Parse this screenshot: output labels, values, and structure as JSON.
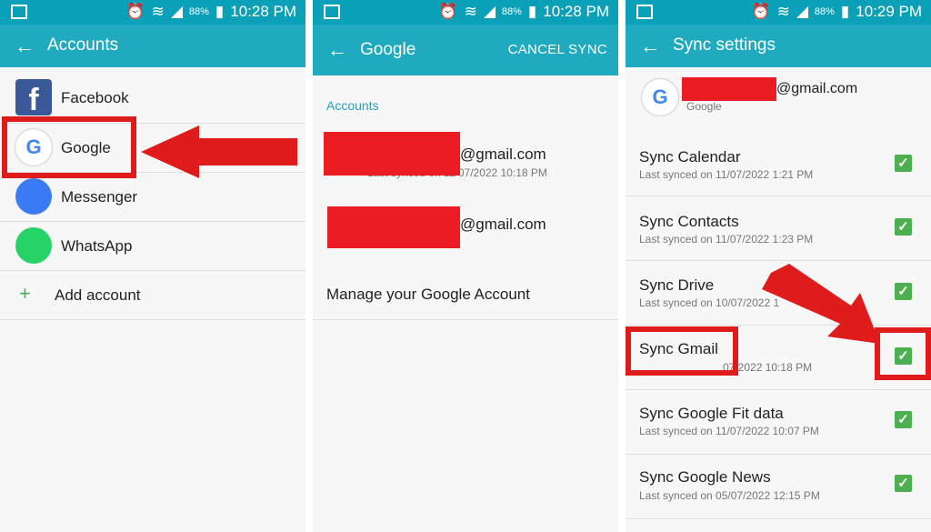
{
  "status": {
    "battery": "88%",
    "times": [
      "10:28 PM",
      "10:28 PM",
      "10:29 PM"
    ]
  },
  "panel1": {
    "title": "Accounts",
    "items": [
      {
        "label": "Facebook"
      },
      {
        "label": "Google"
      },
      {
        "label": "Messenger"
      },
      {
        "label": "WhatsApp"
      }
    ],
    "add_account": "Add account"
  },
  "panel2": {
    "title": "Google",
    "cancel_sync": "CANCEL SYNC",
    "section": "Accounts",
    "accounts": [
      {
        "email_suffix": "@gmail.com",
        "last_synced": "Last synced on 11/07/2022 10:18 PM"
      },
      {
        "email_suffix": "@gmail.com"
      }
    ],
    "manage": "Manage your Google Account"
  },
  "panel3": {
    "title": "Sync settings",
    "account_email_suffix": "@gmail.com",
    "account_type": "Google",
    "items": [
      {
        "label": "Sync Calendar",
        "sub": "Last synced on 11/07/2022 1:21 PM",
        "checked": true
      },
      {
        "label": "Sync Contacts",
        "sub": "Last synced on 11/07/2022 1:23 PM",
        "checked": true
      },
      {
        "label": "Sync Drive",
        "sub": "Last synced on 10/07/2022 1",
        "checked": true
      },
      {
        "label": "Sync Gmail",
        "sub": "07/2022 10:18 PM",
        "checked": true
      },
      {
        "label": "Sync Google Fit data",
        "sub": "Last synced on 11/07/2022 10:07 PM",
        "checked": true
      },
      {
        "label": "Sync Google News",
        "sub": "Last synced on 05/07/2022 12:15 PM",
        "checked": true
      }
    ]
  },
  "colors": {
    "accent": "#1faabf",
    "annotation_red": "#e01b1b",
    "check_green": "#4caf50"
  }
}
